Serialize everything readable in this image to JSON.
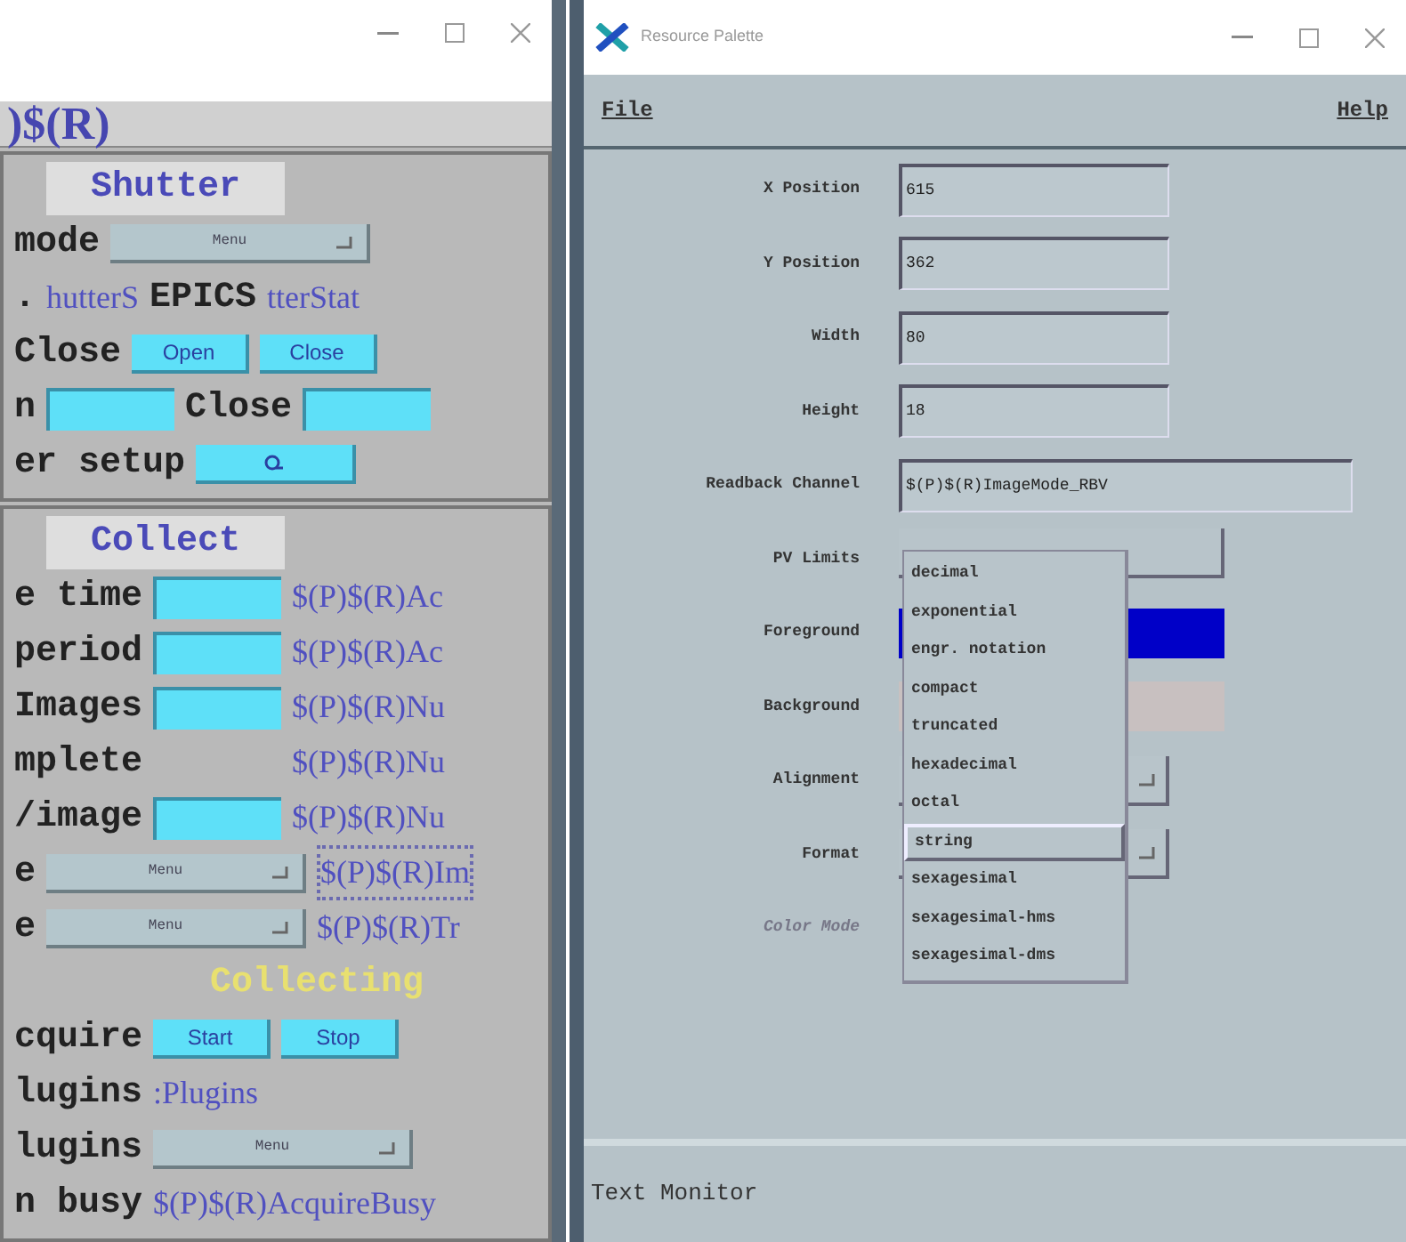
{
  "left_window": {
    "header": ")$(R)",
    "panels": [
      {
        "title": "Shutter",
        "rows": [
          {
            "items": [
              {
                "kind": "label",
                "text": "mode"
              },
              {
                "kind": "menu",
                "text": "Menu"
              }
            ]
          },
          {
            "items": [
              {
                "kind": "label",
                "text": "."
              },
              {
                "kind": "pv",
                "text": "hutterS",
                "selected": false
              },
              {
                "kind": "label",
                "text": "EPICS"
              },
              {
                "kind": "pv",
                "text": "tterStat",
                "selected": false
              }
            ]
          },
          {
            "items": [
              {
                "kind": "label",
                "text": "Close"
              },
              {
                "kind": "button",
                "text": "Open"
              },
              {
                "kind": "button",
                "text": "Close"
              }
            ]
          },
          {
            "items": [
              {
                "kind": "label",
                "text": "n"
              },
              {
                "kind": "field"
              },
              {
                "kind": "label",
                "text": "Close"
              },
              {
                "kind": "field"
              }
            ]
          },
          {
            "items": [
              {
                "kind": "label",
                "text": "er setup"
              },
              {
                "kind": "iconbutton"
              }
            ]
          }
        ]
      },
      {
        "title": "Collect",
        "rows": [
          {
            "items": [
              {
                "kind": "label",
                "text": "e time"
              },
              {
                "kind": "field"
              },
              {
                "kind": "pv",
                "text": "$(P)$(R)Ac",
                "selected": false
              }
            ]
          },
          {
            "items": [
              {
                "kind": "label",
                "text": "period"
              },
              {
                "kind": "field"
              },
              {
                "kind": "pv",
                "text": "$(P)$(R)Ac",
                "selected": false
              }
            ]
          },
          {
            "items": [
              {
                "kind": "label",
                "text": "Images"
              },
              {
                "kind": "field"
              },
              {
                "kind": "pv",
                "text": "$(P)$(R)Nu",
                "selected": false
              }
            ]
          },
          {
            "items": [
              {
                "kind": "label",
                "text": "mplete"
              },
              {
                "kind": "spacer"
              },
              {
                "kind": "pv",
                "text": "$(P)$(R)Nu",
                "selected": false
              }
            ]
          },
          {
            "items": [
              {
                "kind": "label",
                "text": "/image"
              },
              {
                "kind": "field"
              },
              {
                "kind": "pv",
                "text": "$(P)$(R)Nu",
                "selected": false
              }
            ]
          },
          {
            "items": [
              {
                "kind": "label",
                "text": "e"
              },
              {
                "kind": "menu",
                "text": "Menu"
              },
              {
                "kind": "pv",
                "text": "$(P)$(R)Im",
                "selected": true
              }
            ]
          },
          {
            "items": [
              {
                "kind": "label",
                "text": "e"
              },
              {
                "kind": "menu",
                "text": "Menu"
              },
              {
                "kind": "pv",
                "text": "$(P)$(R)Tr",
                "selected": false
              }
            ]
          },
          {
            "items": [
              {
                "kind": "status",
                "text": "Collecting",
                "color": "#e8e070"
              }
            ]
          },
          {
            "items": [
              {
                "kind": "label",
                "text": "cquire"
              },
              {
                "kind": "button",
                "text": "Start"
              },
              {
                "kind": "button",
                "text": "Stop"
              }
            ]
          },
          {
            "items": [
              {
                "kind": "label",
                "text": "lugins"
              },
              {
                "kind": "pv",
                "text": ":Plugins",
                "selected": false
              }
            ]
          },
          {
            "items": [
              {
                "kind": "label",
                "text": "lugins"
              },
              {
                "kind": "menu",
                "text": "Menu"
              }
            ]
          },
          {
            "items": [
              {
                "kind": "label",
                "text": "n busy"
              },
              {
                "kind": "pv",
                "text": "$(P)$(R)AcquireBusy",
                "selected": false
              }
            ]
          }
        ]
      }
    ]
  },
  "right_window": {
    "title": "Resource Palette",
    "menu": [
      {
        "label": "File"
      },
      {
        "label": "Help"
      }
    ],
    "properties": [
      {
        "label": "X Position",
        "kind": "field",
        "value": "615"
      },
      {
        "label": "Y Position",
        "kind": "field",
        "value": "362"
      },
      {
        "label": "Width",
        "kind": "field",
        "value": "80"
      },
      {
        "label": "Height",
        "kind": "field",
        "value": "18"
      },
      {
        "label": "Readback Channel",
        "kind": "widefield",
        "value": "$(P)$(R)ImageMode_RBV"
      },
      {
        "label": "PV Limits",
        "kind": "button"
      },
      {
        "label": "Foreground",
        "kind": "swatch",
        "color": "#0000c8"
      },
      {
        "label": "Background",
        "kind": "swatch",
        "color": "#c8c0c0"
      },
      {
        "label": "Alignment",
        "kind": "menu"
      },
      {
        "label": "Format",
        "kind": "menu"
      },
      {
        "label": "Color Mode",
        "kind": "hidden"
      }
    ],
    "format_options": [
      {
        "label": "decimal",
        "selected": false
      },
      {
        "label": "exponential",
        "selected": false
      },
      {
        "label": "engr. notation",
        "selected": false
      },
      {
        "label": "compact",
        "selected": false
      },
      {
        "label": "truncated",
        "selected": false
      },
      {
        "label": "hexadecimal",
        "selected": false
      },
      {
        "label": "octal",
        "selected": false
      },
      {
        "label": "string",
        "selected": true
      },
      {
        "label": "sexagesimal",
        "selected": false
      },
      {
        "label": "sexagesimal-hms",
        "selected": false
      },
      {
        "label": "sexagesimal-dms",
        "selected": false
      }
    ],
    "status": "Text Monitor"
  }
}
